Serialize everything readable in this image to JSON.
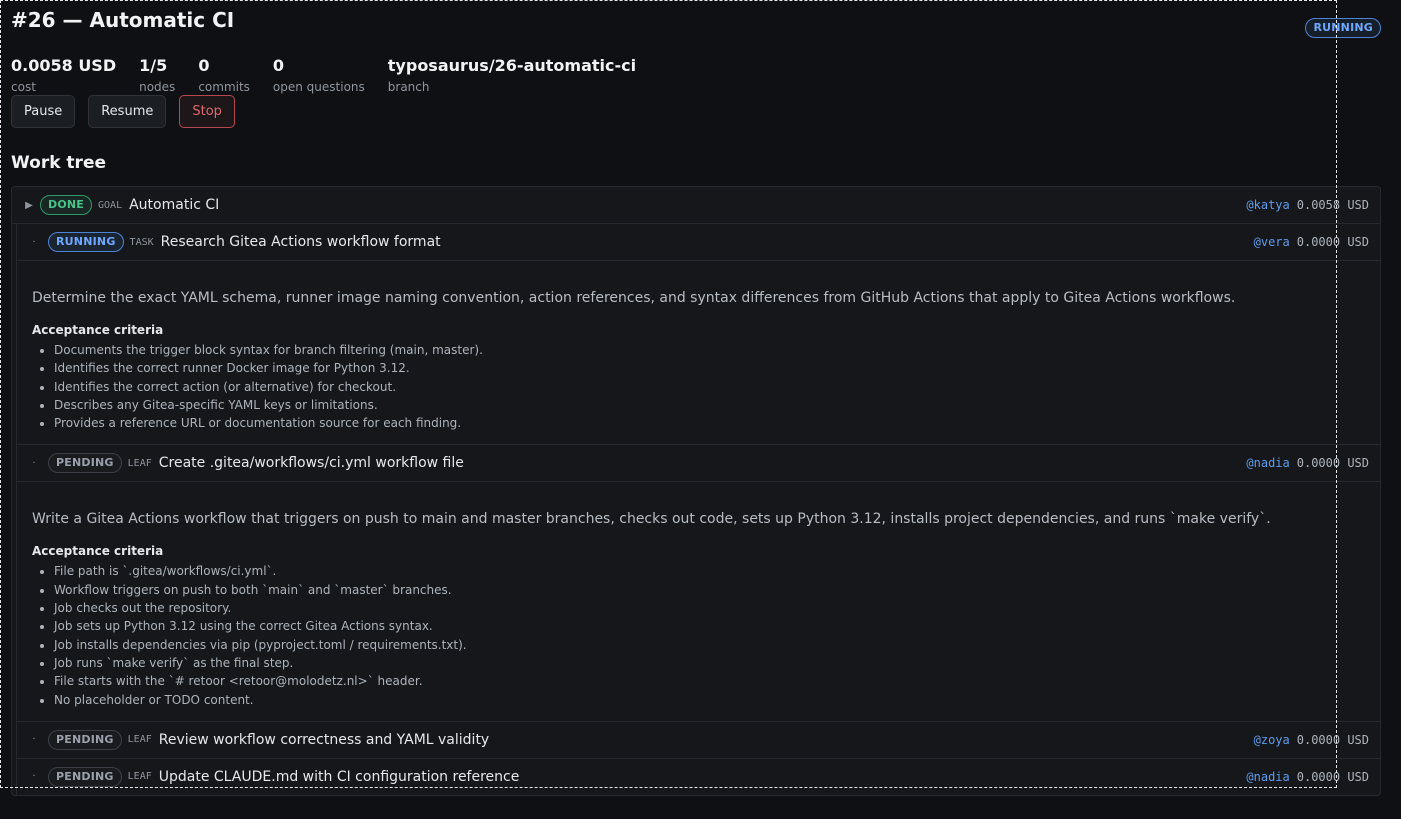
{
  "header": {
    "title": "#26 — Automatic CI",
    "status": "RUNNING"
  },
  "stats": {
    "cost": {
      "value": "0.0058 USD",
      "label": "cost"
    },
    "nodes": {
      "value": "1/5",
      "label": "nodes"
    },
    "commits": {
      "value": "0",
      "label": "commits"
    },
    "questions": {
      "value": "0",
      "label": "open questions"
    },
    "branch": {
      "value": "typosaurus/26-automatic-ci",
      "label": "branch"
    }
  },
  "actions": {
    "pause": "Pause",
    "resume": "Resume",
    "stop": "Stop"
  },
  "tree": {
    "heading": "Work tree",
    "goal": {
      "toggle": "▶",
      "status": "DONE",
      "kind": "GOAL",
      "title": "Automatic CI",
      "assignee": "@katya",
      "cost": "0.0058 USD"
    },
    "nodes": [
      {
        "toggle": "·",
        "status": "RUNNING",
        "kind": "TASK",
        "title": "Research Gitea Actions workflow format",
        "assignee": "@vera",
        "cost": "0.0000 USD",
        "description": "Determine the exact YAML schema, runner image naming convention, action references, and syntax differences from GitHub Actions that apply to Gitea Actions workflows.",
        "ac_label": "Acceptance criteria",
        "criteria": [
          "Documents the trigger block syntax for branch filtering (main, master).",
          "Identifies the correct runner Docker image for Python 3.12.",
          "Identifies the correct action (or alternative) for checkout.",
          "Describes any Gitea-specific YAML keys or limitations.",
          "Provides a reference URL or documentation source for each finding."
        ]
      },
      {
        "toggle": "·",
        "status": "PENDING",
        "kind": "LEAF",
        "title": "Create .gitea/workflows/ci.yml workflow file",
        "assignee": "@nadia",
        "cost": "0.0000 USD",
        "description": "Write a Gitea Actions workflow that triggers on push to main and master branches, checks out code, sets up Python 3.12, installs project dependencies, and runs `make verify`.",
        "ac_label": "Acceptance criteria",
        "criteria": [
          "File path is `.gitea/workflows/ci.yml`.",
          "Workflow triggers on push to both `main` and `master` branches.",
          "Job checks out the repository.",
          "Job sets up Python 3.12 using the correct Gitea Actions syntax.",
          "Job installs dependencies via pip (pyproject.toml / requirements.txt).",
          "Job runs `make verify` as the final step.",
          "File starts with the `# retoor <retoor@molodetz.nl>` header.",
          "No placeholder or TODO content."
        ]
      },
      {
        "toggle": "·",
        "status": "PENDING",
        "kind": "LEAF",
        "title": "Review workflow correctness and YAML validity",
        "assignee": "@zoya",
        "cost": "0.0000 USD"
      },
      {
        "toggle": "·",
        "status": "PENDING",
        "kind": "LEAF",
        "title": "Update CLAUDE.md with CI configuration reference",
        "assignee": "@nadia",
        "cost": "0.0000 USD"
      }
    ]
  }
}
